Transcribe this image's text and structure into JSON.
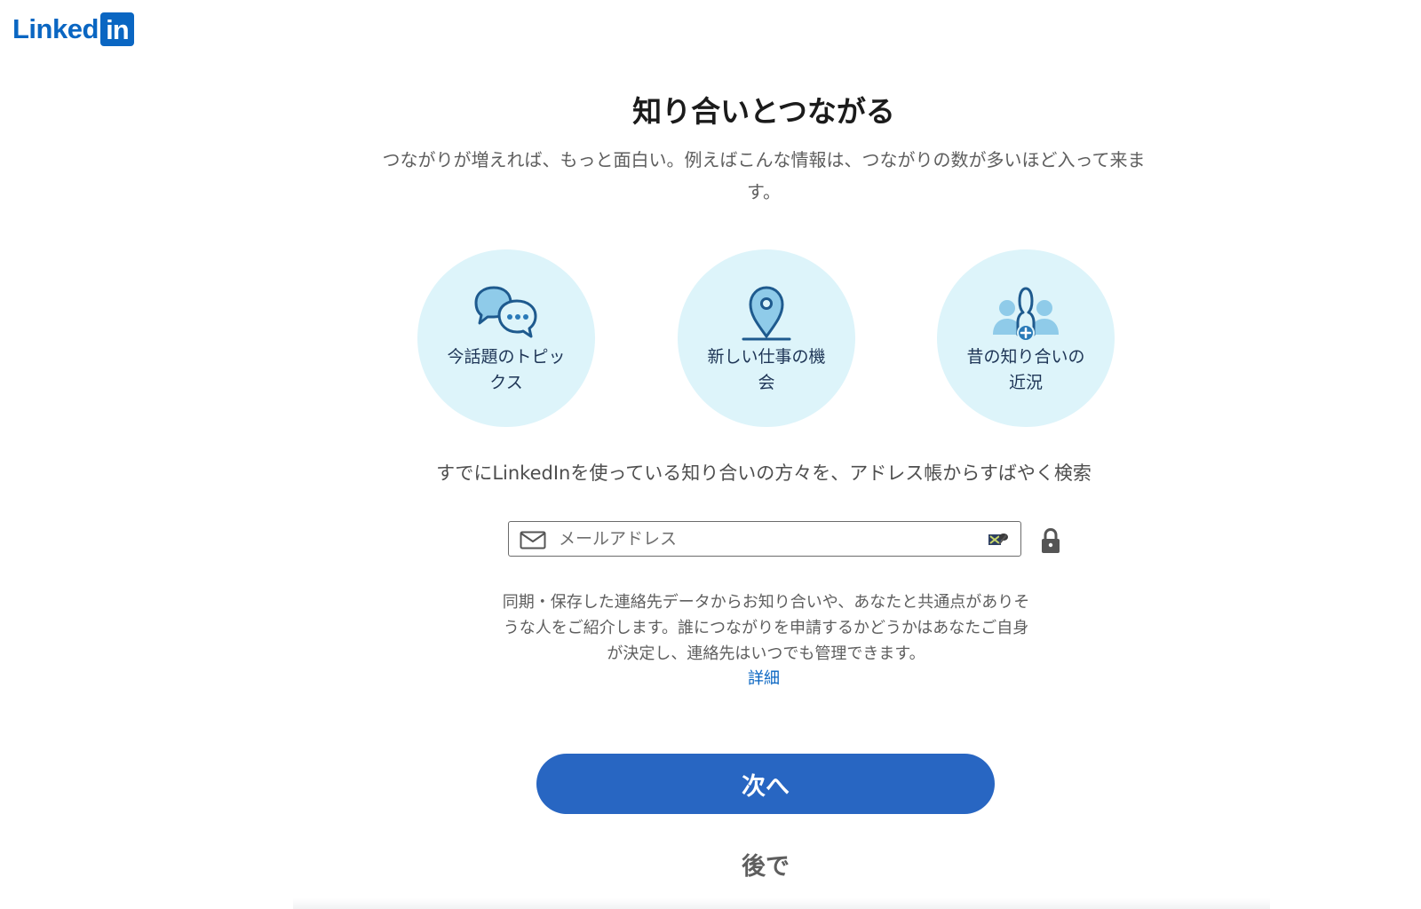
{
  "brand": {
    "name_part": "Linked",
    "box_part": "in",
    "color": "#0a66c2"
  },
  "heading": {
    "title": "知り合いとつながる",
    "subtitle": "つながりが増えれば、もっと面白い。例えばこんな情報は、つながりの数が多いほど入って来ます。"
  },
  "features": [
    {
      "icon": "chat-bubbles-icon",
      "label": "今話題のトピックス"
    },
    {
      "icon": "location-pin-icon",
      "label": "新しい仕事の機会"
    },
    {
      "icon": "people-add-icon",
      "label": "昔の知り合いの近況"
    }
  ],
  "import": {
    "prompt": "すでにLinkedInを使っている知り合いの方々を、アドレス帳からすばやく検索",
    "email_placeholder": "メールアドレス",
    "email_value": ""
  },
  "privacy": {
    "text": "同期・保存した連絡先データからお知り合いや、あなたと共通点がありそうな人をご紹介します。誰につながりを申請するかどうかはあなたご自身が決定し、連絡先はいつでも管理できます。",
    "link_label": "詳細"
  },
  "actions": {
    "next_label": "次へ",
    "later_label": "後で"
  },
  "colors": {
    "accent": "#2866c2",
    "feature_bg": "#ddf4fa",
    "icon_dark": "#1e5a8e",
    "icon_light": "#8fcbe9"
  }
}
